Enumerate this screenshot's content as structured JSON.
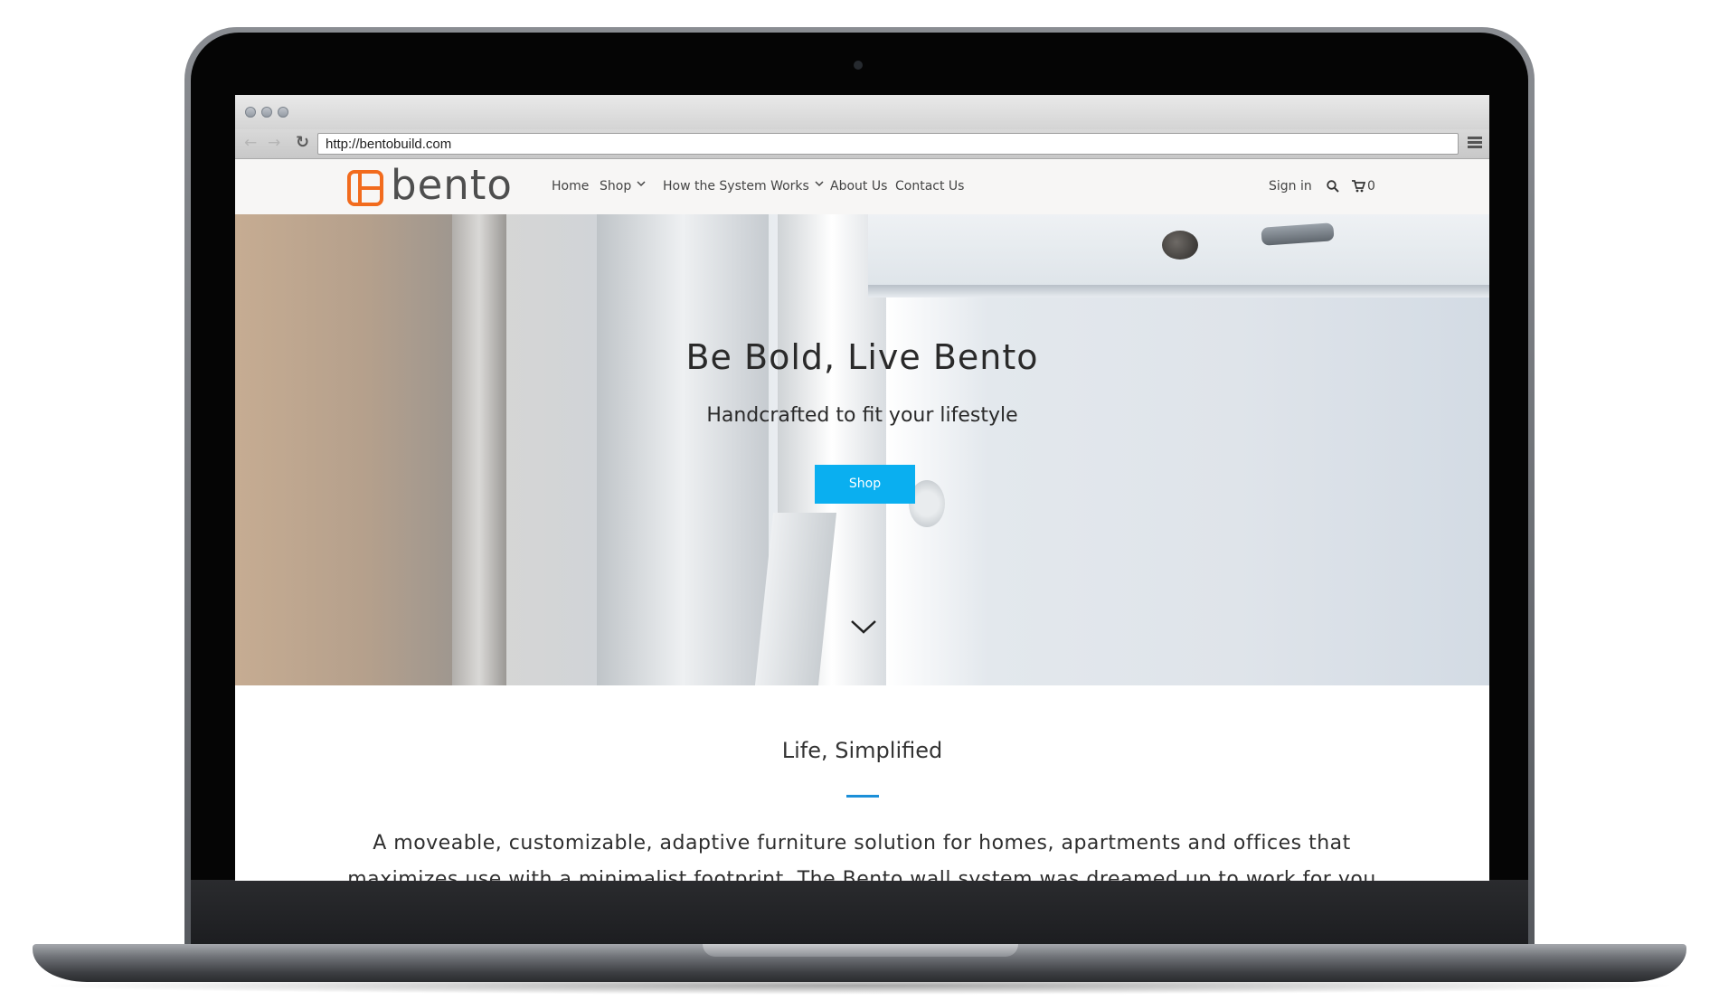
{
  "browser": {
    "url": "http://bentobuild.com",
    "back_icon": "arrow-left-icon",
    "forward_icon": "arrow-right-icon",
    "reload_icon": "reload-icon",
    "menu_icon": "hamburger-icon"
  },
  "site": {
    "logo_text": "bento",
    "brand_color": "#f26b1d",
    "nav": [
      {
        "label": "Home"
      },
      {
        "label": "Shop",
        "dropdown": true
      },
      {
        "label": "How the System Works",
        "dropdown": true
      },
      {
        "label": "About Us"
      },
      {
        "label": "Contact Us"
      }
    ],
    "sign_in": "Sign in",
    "search_icon": "search-icon",
    "cart_icon": "cart-icon",
    "cart_count": "0"
  },
  "hero": {
    "title": "Be Bold, Live Bento",
    "subtitle": "Handcrafted to fit your lifestyle",
    "button_label": "Shop",
    "button_color": "#0aaff0",
    "scroll_icon": "chevron-down-icon"
  },
  "intro": {
    "title": "Life, Simplified",
    "accent_color": "#1b8fd8",
    "body": "A moveable, customizable, adaptive furniture solution for homes, apartments and offices that maximizes use with a minimalist footprint. The Bento wall system was dreamed up to work for you"
  }
}
